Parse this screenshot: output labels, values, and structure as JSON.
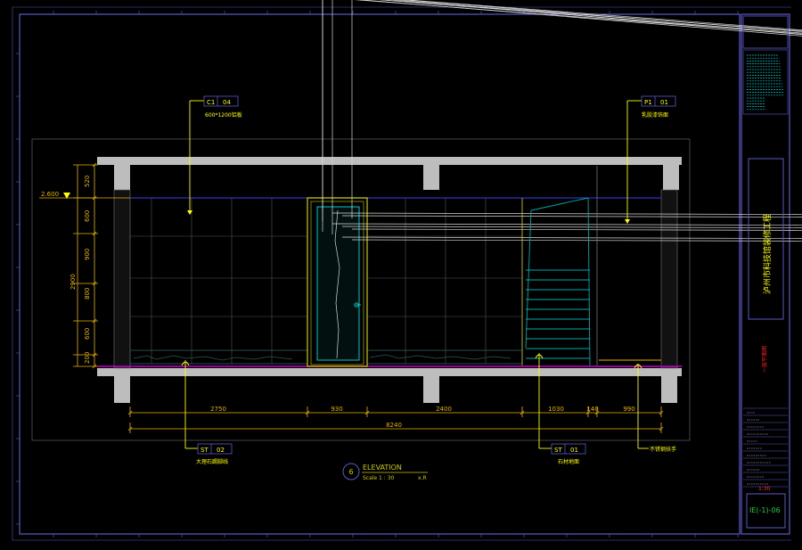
{
  "drawing": {
    "title": "ELEVATION",
    "scale_text": "Scale 1 : 30",
    "elevation_index": "6",
    "sheet_suffix": "x.R",
    "level_mark": "2.600"
  },
  "tags": {
    "ceiling": {
      "code": "C1",
      "num": "04",
      "note": "600*1200铝板"
    },
    "paint": {
      "code": "P1",
      "num": "01",
      "note": "乳胶漆饰面"
    },
    "floor_left": {
      "code": "ST",
      "num": "02",
      "note": "大理石踢脚线"
    },
    "floor_right": {
      "code": "ST",
      "num": "01",
      "note": "石材地面"
    },
    "handrail_note": "不锈钢扶手"
  },
  "dims": {
    "horizontal": [
      "2750",
      "930",
      "2400",
      "1030",
      "140",
      "990"
    ],
    "total": "8240",
    "vertical": [
      "520",
      "600",
      "900",
      "800",
      "600",
      "200"
    ],
    "vertical_total": "2900"
  },
  "title_block": {
    "project_name": "泸州市科技馆装修工程",
    "sheet_label": "一层平面图",
    "drawing_number": "IE(-1)-06",
    "scale_note": "1:30"
  },
  "colors": {
    "frame": "#5a5ac8",
    "leader": "#ffff00",
    "dim": "#e6b400",
    "structure": "#bdbdbd",
    "glass": "#3c6e6e",
    "cyan": "#00d2d2",
    "floor_line": "#c800c8"
  }
}
